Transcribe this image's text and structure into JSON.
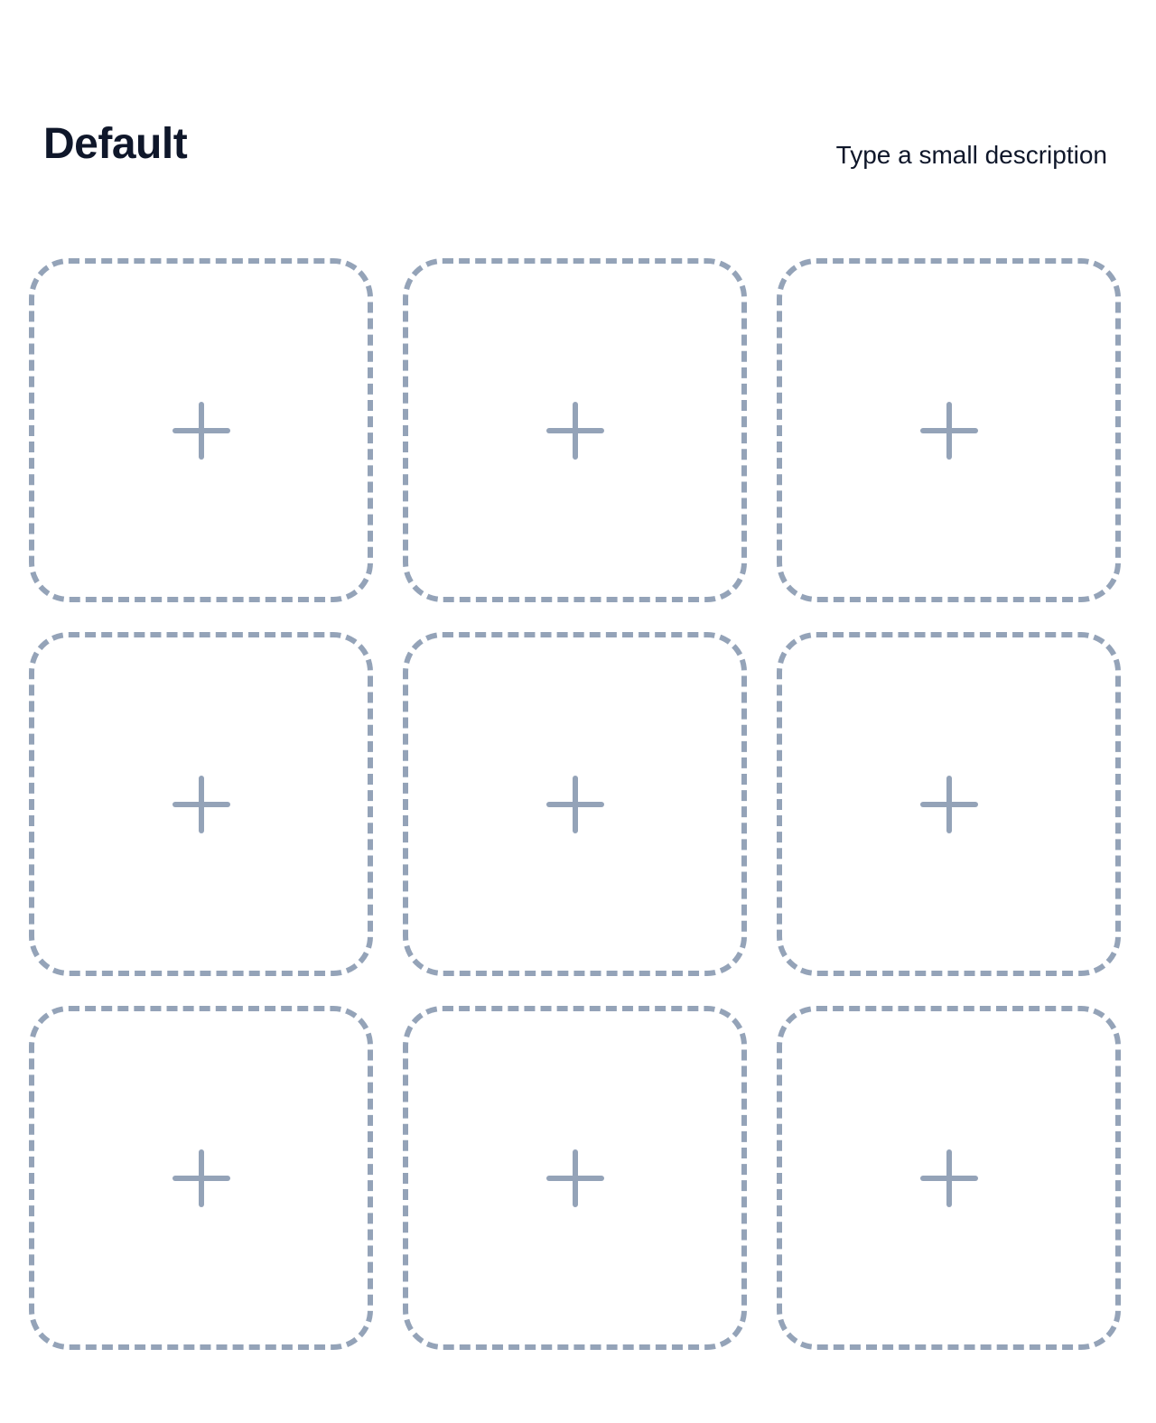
{
  "header": {
    "title": "Default",
    "description": "Type a small description"
  },
  "colors": {
    "title_text": "#0f172a",
    "tile_border": "#94a3b8",
    "plus_icon": "#94a3b8",
    "background": "#ffffff"
  },
  "grid": {
    "tiles": [
      {
        "icon": "plus-icon"
      },
      {
        "icon": "plus-icon"
      },
      {
        "icon": "plus-icon"
      },
      {
        "icon": "plus-icon"
      },
      {
        "icon": "plus-icon"
      },
      {
        "icon": "plus-icon"
      },
      {
        "icon": "plus-icon"
      },
      {
        "icon": "plus-icon"
      },
      {
        "icon": "plus-icon"
      }
    ]
  }
}
